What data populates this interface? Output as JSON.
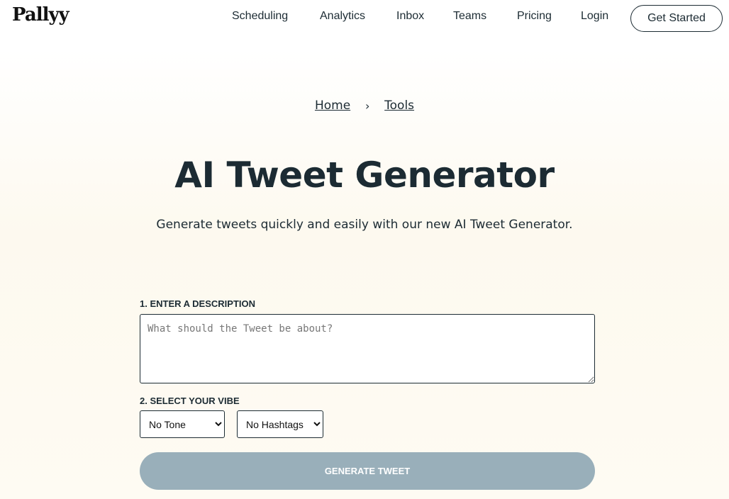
{
  "brand": {
    "logo_text": "Pallyy"
  },
  "nav": {
    "items": [
      {
        "label": "Scheduling"
      },
      {
        "label": "Analytics"
      },
      {
        "label": "Inbox"
      },
      {
        "label": "Teams"
      },
      {
        "label": "Pricing"
      },
      {
        "label": "Login"
      }
    ],
    "cta_label": "Get Started"
  },
  "breadcrumb": {
    "items": [
      {
        "label": "Home"
      },
      {
        "label": "Tools"
      }
    ],
    "separator": "›"
  },
  "hero": {
    "title": "AI Tweet Generator",
    "subtitle": "Generate tweets quickly and easily with our new AI Tweet Generator."
  },
  "form": {
    "step1_label": "1. ENTER A DESCRIPTION",
    "description_placeholder": "What should the Tweet be about?",
    "description_value": "",
    "step2_label": "2. SELECT YOUR VIBE",
    "tone_selected": "No Tone",
    "hashtags_selected": "No Hashtags",
    "generate_label": "GENERATE TWEET"
  },
  "colors": {
    "text": "#1c2b33",
    "button_disabled": "#99afba",
    "background_warm": "#fdf9ef"
  }
}
